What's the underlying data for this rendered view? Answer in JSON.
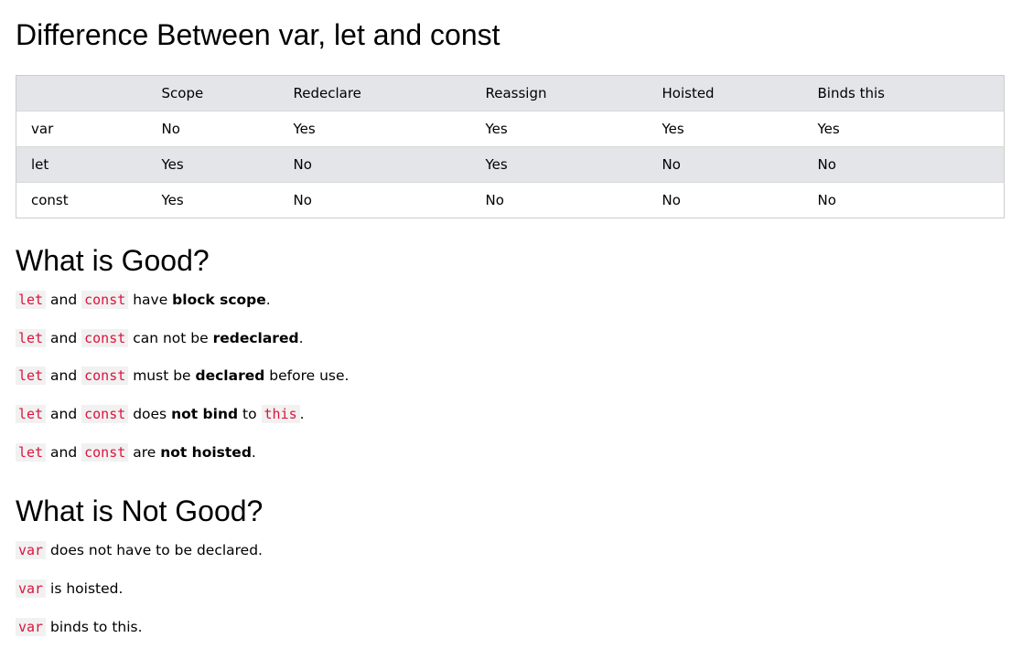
{
  "headings": {
    "main": "Difference Between var, let and const",
    "good": "What is Good?",
    "not_good": "What is Not Good?"
  },
  "table": {
    "headers": [
      "",
      "Scope",
      "Redeclare",
      "Reassign",
      "Hoisted",
      "Binds this"
    ],
    "rows": [
      [
        "var",
        "No",
        "Yes",
        "Yes",
        "Yes",
        "Yes"
      ],
      [
        "let",
        "Yes",
        "No",
        "Yes",
        "No",
        "No"
      ],
      [
        "const",
        "Yes",
        "No",
        "No",
        "No",
        "No"
      ]
    ]
  },
  "good": {
    "kw_let": "let",
    "kw_const": "const",
    "kw_this": "this",
    "and": " and ",
    "line1": {
      "pre": " have ",
      "bold": "block scope",
      "post": "."
    },
    "line2": {
      "pre": " can not be ",
      "bold": "redeclared",
      "post": "."
    },
    "line3": {
      "pre": " must be ",
      "bold": "declared",
      "post": " before use."
    },
    "line4": {
      "pre": " does ",
      "bold": "not bind",
      "mid": " to ",
      "post": "."
    },
    "line5": {
      "pre": " are ",
      "bold": "not hoisted",
      "post": "."
    }
  },
  "not_good": {
    "kw_var": "var",
    "line1": " does not have to be declared.",
    "line2": " is hoisted.",
    "line3": " binds to this."
  }
}
